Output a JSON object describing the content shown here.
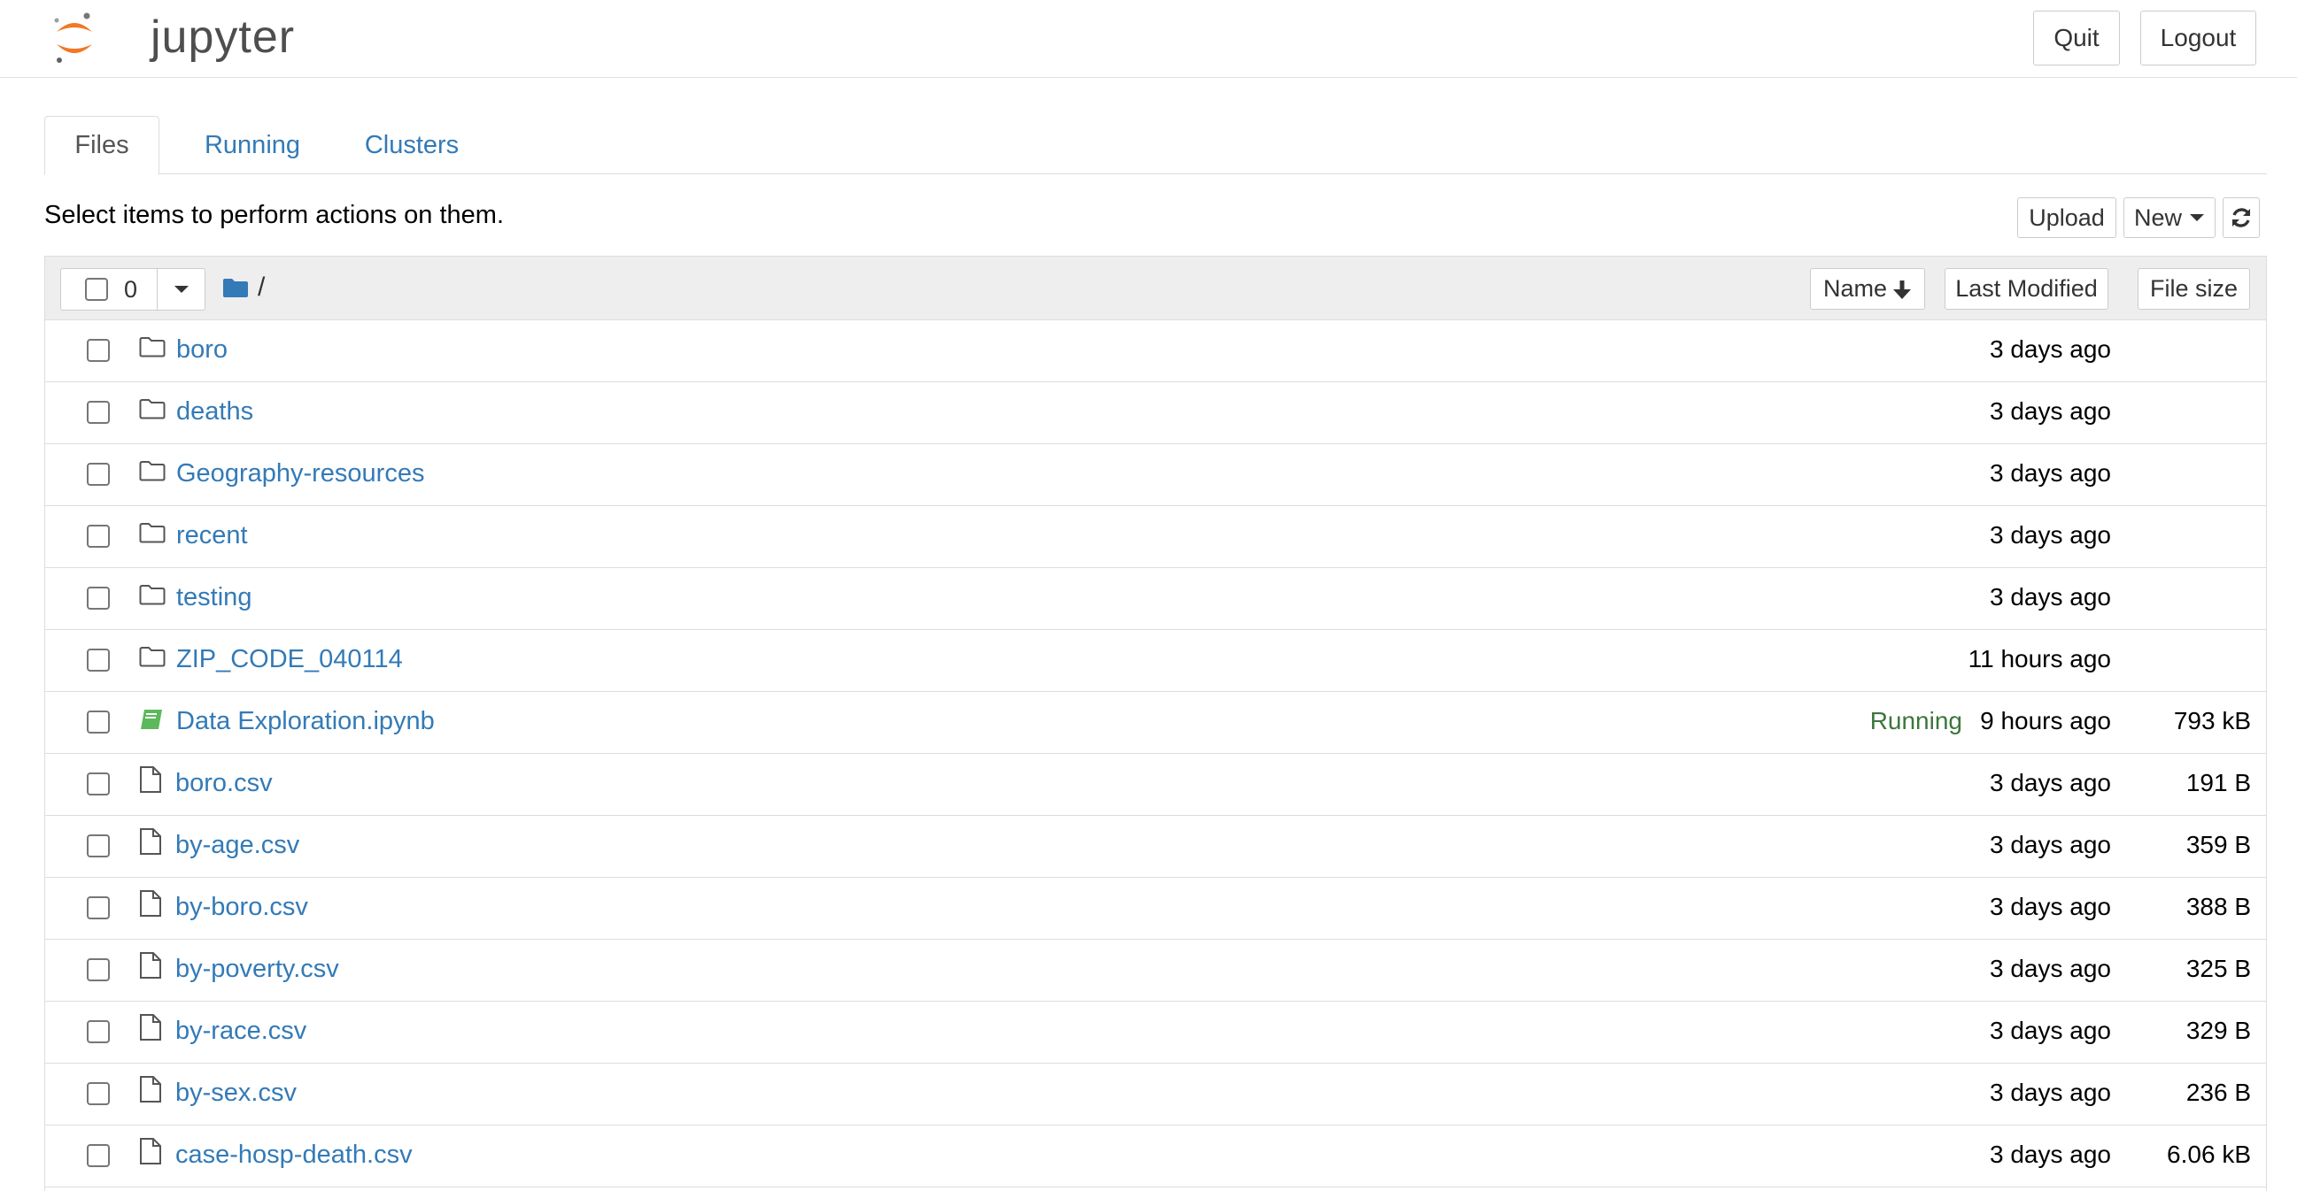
{
  "header": {
    "logo_text": "jupyter",
    "quit_label": "Quit",
    "logout_label": "Logout"
  },
  "tabs": [
    {
      "label": "Files",
      "active": true
    },
    {
      "label": "Running",
      "active": false
    },
    {
      "label": "Clusters",
      "active": false
    }
  ],
  "toolbar": {
    "hint": "Select items to perform actions on them.",
    "upload_label": "Upload",
    "new_label": "New",
    "refresh_icon": "refresh-icon"
  },
  "list_header": {
    "selected_count": "0",
    "breadcrumb": "/",
    "sort_name_label": "Name",
    "sort_modified_label": "Last Modified",
    "sort_size_label": "File size"
  },
  "colors": {
    "link": "#337ab7",
    "running": "#3c763d",
    "notebook_icon": "#5cb85c",
    "logo_orange": "#f37726"
  },
  "files": [
    {
      "type": "folder",
      "name": "boro",
      "status": "",
      "modified": "3 days ago",
      "size": ""
    },
    {
      "type": "folder",
      "name": "deaths",
      "status": "",
      "modified": "3 days ago",
      "size": ""
    },
    {
      "type": "folder",
      "name": "Geography-resources",
      "status": "",
      "modified": "3 days ago",
      "size": ""
    },
    {
      "type": "folder",
      "name": "recent",
      "status": "",
      "modified": "3 days ago",
      "size": ""
    },
    {
      "type": "folder",
      "name": "testing",
      "status": "",
      "modified": "3 days ago",
      "size": ""
    },
    {
      "type": "folder",
      "name": "ZIP_CODE_040114",
      "status": "",
      "modified": "11 hours ago",
      "size": ""
    },
    {
      "type": "notebook",
      "name": "Data Exploration.ipynb",
      "status": "Running",
      "modified": "9 hours ago",
      "size": "793 kB"
    },
    {
      "type": "file",
      "name": "boro.csv",
      "status": "",
      "modified": "3 days ago",
      "size": "191 B"
    },
    {
      "type": "file",
      "name": "by-age.csv",
      "status": "",
      "modified": "3 days ago",
      "size": "359 B"
    },
    {
      "type": "file",
      "name": "by-boro.csv",
      "status": "",
      "modified": "3 days ago",
      "size": "388 B"
    },
    {
      "type": "file",
      "name": "by-poverty.csv",
      "status": "",
      "modified": "3 days ago",
      "size": "325 B"
    },
    {
      "type": "file",
      "name": "by-race.csv",
      "status": "",
      "modified": "3 days ago",
      "size": "329 B"
    },
    {
      "type": "file",
      "name": "by-sex.csv",
      "status": "",
      "modified": "3 days ago",
      "size": "236 B"
    },
    {
      "type": "file",
      "name": "case-hosp-death.csv",
      "status": "",
      "modified": "3 days ago",
      "size": "6.06 kB"
    }
  ]
}
